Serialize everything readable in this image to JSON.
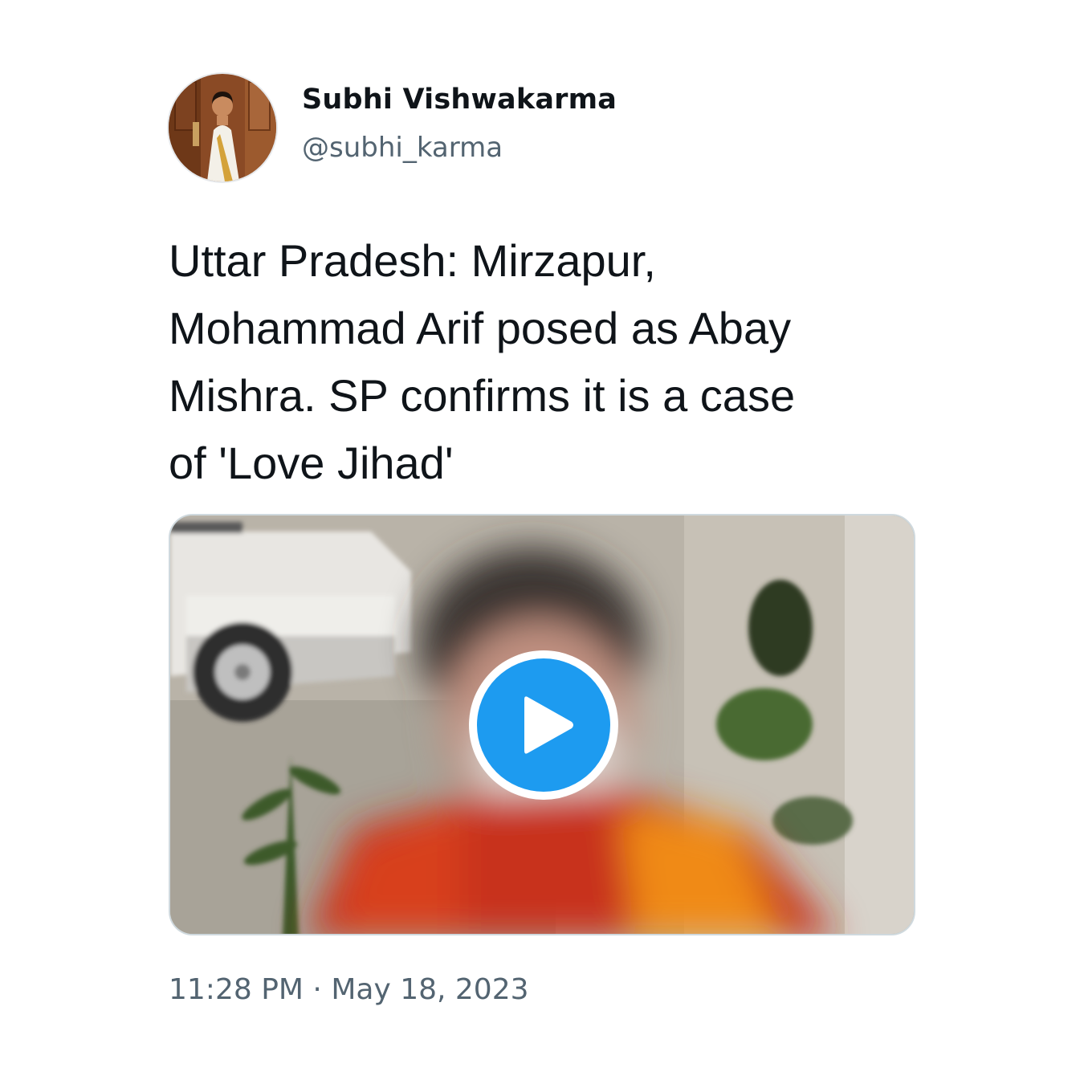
{
  "author": {
    "display_name": "Subhi Vishwakarma",
    "handle": "@subhi_karma",
    "avatar_icon": "profile-photo"
  },
  "tweet": {
    "text_lines": [
      "Uttar Pradesh: Mirzapur,",
      "Mohammad Arif posed as Abay",
      "Mishra. SP confirms it is a case",
      "of 'Love Jihad'"
    ],
    "media": {
      "type": "video",
      "play_icon": "play-icon",
      "accent_color": "#1d9bf0"
    },
    "time": "11:28 PM",
    "separator": "·",
    "date": "May 18, 2023"
  },
  "colors": {
    "text_primary": "#0f1419",
    "text_secondary": "#536471",
    "border": "#cfd9de"
  }
}
